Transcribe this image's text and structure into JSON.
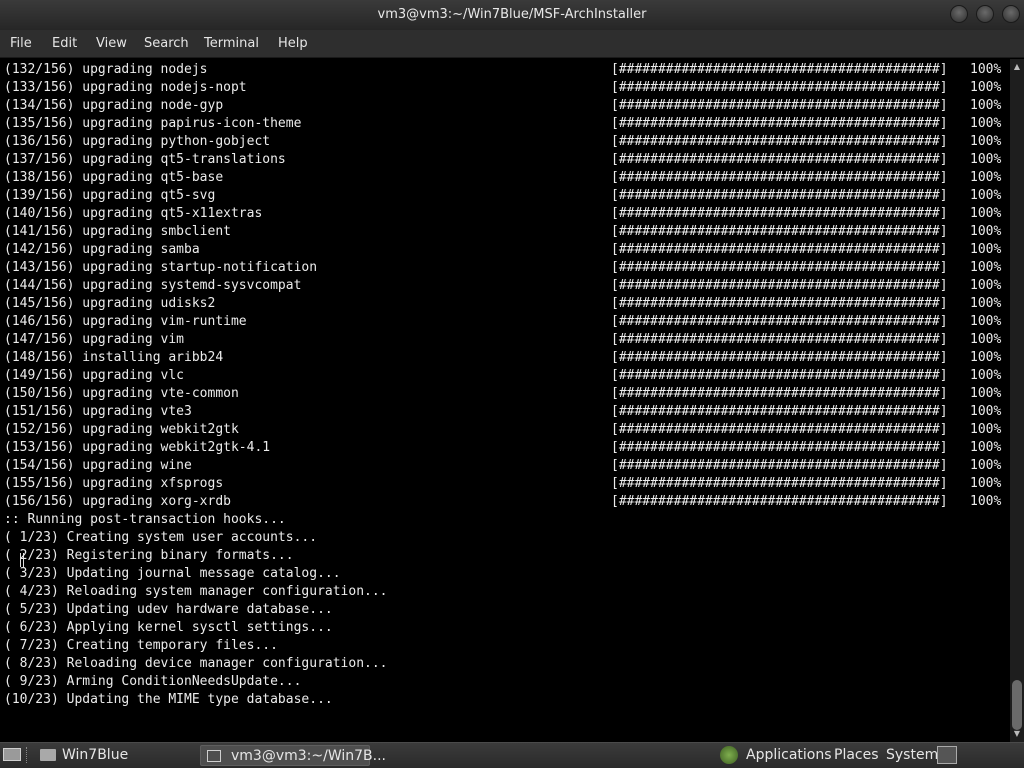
{
  "window": {
    "title": "vm3@vm3:~/Win7Blue/MSF-ArchInstaller"
  },
  "menu": [
    "File",
    "Edit",
    "View",
    "Search",
    "Terminal",
    "Help"
  ],
  "progress_bar_text": "[#########################################]",
  "progress_pct": "100%",
  "package_lines": [
    "(132/156) upgrading nodejs",
    "(133/156) upgrading nodejs-nopt",
    "(134/156) upgrading node-gyp",
    "(135/156) upgrading papirus-icon-theme",
    "(136/156) upgrading python-gobject",
    "(137/156) upgrading qt5-translations",
    "(138/156) upgrading qt5-base",
    "(139/156) upgrading qt5-svg",
    "(140/156) upgrading qt5-x11extras",
    "(141/156) upgrading smbclient",
    "(142/156) upgrading samba",
    "(143/156) upgrading startup-notification",
    "(144/156) upgrading systemd-sysvcompat",
    "(145/156) upgrading udisks2",
    "(146/156) upgrading vim-runtime",
    "(147/156) upgrading vim",
    "(148/156) installing aribb24",
    "(149/156) upgrading vlc",
    "(150/156) upgrading vte-common",
    "(151/156) upgrading vte3",
    "(152/156) upgrading webkit2gtk",
    "(153/156) upgrading webkit2gtk-4.1",
    "(154/156) upgrading wine",
    "(155/156) upgrading xfsprogs",
    "(156/156) upgrading xorg-xrdb"
  ],
  "hook_lines": [
    ":: Running post-transaction hooks...",
    "( 1/23) Creating system user accounts...",
    "( 2/23) Registering binary formats...",
    "( 3/23) Updating journal message catalog...",
    "( 4/23) Reloading system manager configuration...",
    "( 5/23) Updating udev hardware database...",
    "( 6/23) Applying kernel sysctl settings...",
    "( 7/23) Creating temporary files...",
    "( 8/23) Reloading device manager configuration...",
    "( 9/23) Arming ConditionNeedsUpdate...",
    "(10/23) Updating the MIME type database..."
  ],
  "taskbar": {
    "folder_label": "Win7Blue",
    "terminal_label": "vm3@vm3:~/Win7B...",
    "applications": "Applications",
    "places": "Places",
    "system": "System"
  }
}
